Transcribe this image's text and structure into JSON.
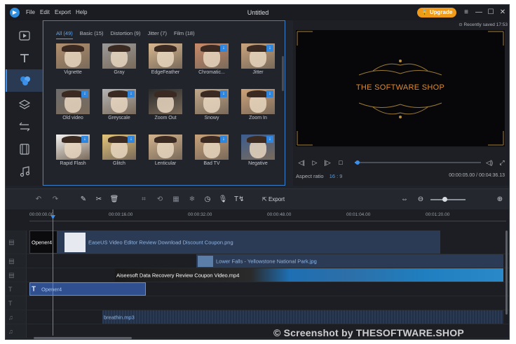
{
  "titlebar": {
    "menus": [
      "File",
      "Edit",
      "Export",
      "Help"
    ],
    "title": "Untitled",
    "upgrade_label": "Upgrade",
    "window_controls": [
      "menu-icon",
      "minimize-icon",
      "maximize-icon",
      "close-icon"
    ]
  },
  "sidebar": {
    "items": [
      {
        "icon": "media-icon"
      },
      {
        "icon": "text-icon"
      },
      {
        "icon": "effects-icon",
        "active": true
      },
      {
        "icon": "layers-icon"
      },
      {
        "icon": "transition-icon"
      },
      {
        "icon": "film-icon"
      },
      {
        "icon": "music-icon"
      }
    ]
  },
  "effects": {
    "tabs": [
      "All (49)",
      "Basic (15)",
      "Distortion (9)",
      "Jitter (7)",
      "Film (18)"
    ],
    "items": [
      {
        "label": "Vignette",
        "color": "#b08f6e",
        "download": false
      },
      {
        "label": "Gray",
        "color": "#9a9a9a",
        "download": false
      },
      {
        "label": "EdgeFeather",
        "color": "#d8b890",
        "download": false
      },
      {
        "label": "Chromatic...",
        "color": "#c98a6a",
        "download": true
      },
      {
        "label": "Jitter",
        "color": "#c9a57e",
        "download": true
      },
      {
        "label": "Old video",
        "color": "#6d6d6d",
        "download": true
      },
      {
        "label": "Greyscale",
        "color": "#b5b5b5",
        "download": true
      },
      {
        "label": "Zoom Out",
        "color": "#2a2a2a",
        "download": false
      },
      {
        "label": "Snowy",
        "color": "#c0a88a",
        "download": true
      },
      {
        "label": "Zoom In",
        "color": "#cda27a",
        "download": true
      },
      {
        "label": "Rapid Flash",
        "color": "#f2f2f2",
        "download": true
      },
      {
        "label": "Glitch",
        "color": "#e2c47a",
        "download": true
      },
      {
        "label": "Lenticular",
        "color": "#d2b38e",
        "download": false
      },
      {
        "label": "Bad TV",
        "color": "#c7a17a",
        "download": true
      },
      {
        "label": "Negative",
        "color": "#3b5d8f",
        "download": true
      }
    ]
  },
  "preview": {
    "saved": "Recently saved 17:53",
    "screen_title": "THE SOFTWARE SHOP",
    "aspect_label": "Aspect ratio",
    "aspect_value": "16 : 9",
    "timecode": "00:00:05.00 / 00:04:36.13",
    "progress": 0.02
  },
  "toolbar": {
    "export_label": "Export",
    "tools": [
      "undo-icon",
      "redo-icon",
      "pen-icon",
      "scissors-icon",
      "trash-icon",
      "crop-icon",
      "rotate-icon",
      "mosaic-icon",
      "freeze-icon",
      "timer-icon",
      "mic-icon",
      "tts-icon"
    ],
    "zoom": 0.4
  },
  "timeline": {
    "ruler": [
      "00:00:00.00",
      "00:00:16.00",
      "00:00:32.00",
      "00:00:48.00",
      "00:01:04.00",
      "00:01:20.00"
    ],
    "clips": {
      "opener_video": "Opener4",
      "image_1": "EaseUS Video Editor Review Download Discount Coupon.png",
      "image_2": "Lower Falls - Yellowstone National Park.jpg",
      "video_1": "Aiseesoft Data Recovery Review Coupon Video.mp4",
      "text_1": "Opener4",
      "audio_1": "breathin.mp3"
    }
  },
  "watermark": "© Screenshot by THESOFTWARE.SHOP"
}
